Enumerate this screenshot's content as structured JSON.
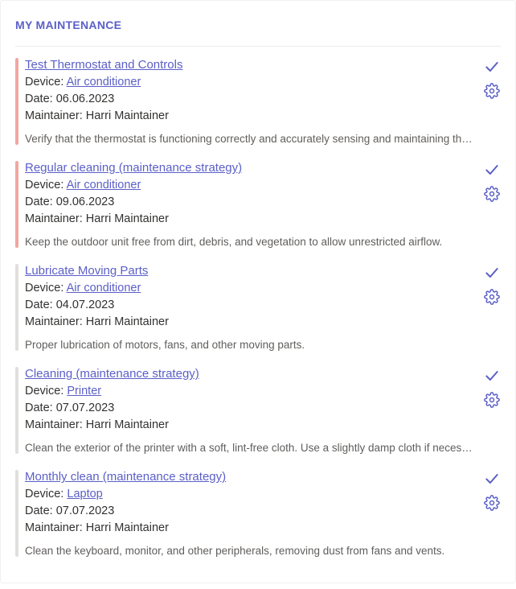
{
  "header": {
    "title": "MY MAINTENANCE"
  },
  "labels": {
    "device_prefix": "Device: ",
    "date_prefix": "Date: ",
    "maintainer_prefix": "Maintainer: "
  },
  "colors": {
    "accent_primary": "#5b5fc7",
    "accent_overdue": "#f1a7a0",
    "accent_normal": "#e1dfdd"
  },
  "items": [
    {
      "title": "Test Thermostat and Controls",
      "device": "Air conditioner",
      "date": "06.06.2023",
      "maintainer": "Harri Maintainer",
      "description": "Verify that the thermostat is functioning correctly and accurately sensing and maintaining the desired temperature.",
      "accent": "overdue"
    },
    {
      "title": "Regular cleaning (maintenance strategy)",
      "device": "Air conditioner",
      "date": "09.06.2023",
      "maintainer": "Harri Maintainer",
      "description": "Keep the outdoor unit free from dirt, debris, and vegetation to allow unrestricted airflow.",
      "accent": "overdue"
    },
    {
      "title": "Lubricate Moving Parts",
      "device": "Air conditioner",
      "date": "04.07.2023",
      "maintainer": "Harri Maintainer",
      "description": "Proper lubrication of motors, fans, and other moving parts.",
      "accent": "normal"
    },
    {
      "title": "Cleaning (maintenance strategy)",
      "device": "Printer",
      "date": "07.07.2023",
      "maintainer": "Harri Maintainer",
      "description": "Clean the exterior of the printer with a soft, lint-free cloth. Use a slightly damp cloth if necessary.",
      "accent": "normal"
    },
    {
      "title": "Monthly clean (maintenance strategy)",
      "device": "Laptop",
      "date": "07.07.2023",
      "maintainer": "Harri Maintainer",
      "description": "Clean the keyboard, monitor, and other peripherals, removing dust from fans and vents.",
      "accent": "normal"
    }
  ]
}
